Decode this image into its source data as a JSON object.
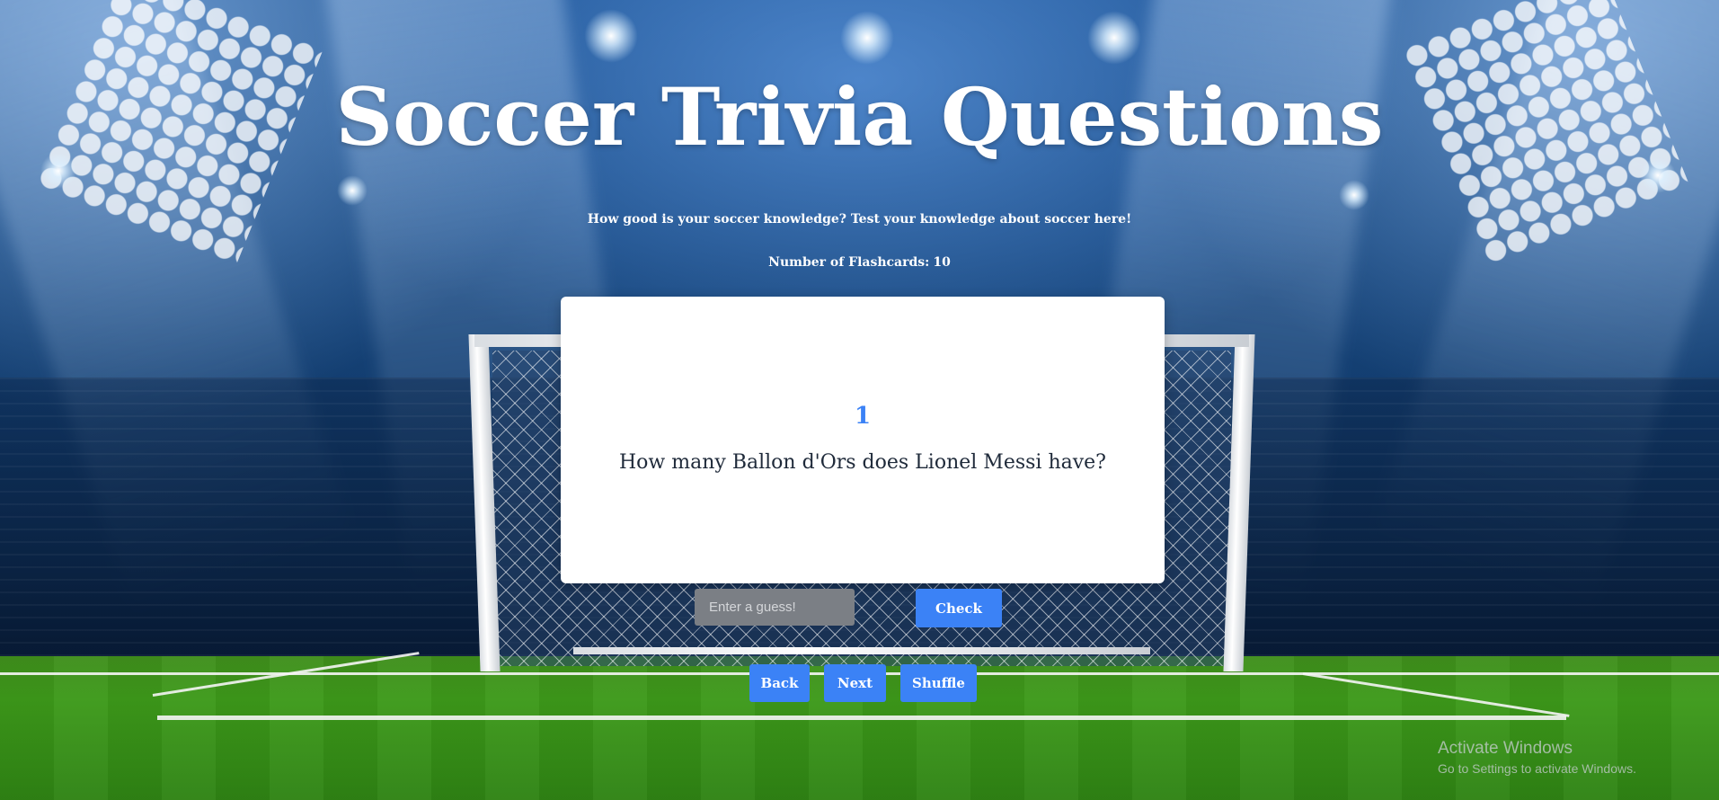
{
  "page": {
    "title": "Soccer Trivia Questions",
    "subtitle": "How good is your soccer knowledge? Test your knowledge about soccer here!",
    "flashcard_count_label": "Number of Flashcards:",
    "flashcard_count": "10"
  },
  "card": {
    "number": "1",
    "question": "How many Ballon d'Ors does Lionel Messi have?"
  },
  "guess": {
    "value": "",
    "placeholder": "Enter a guess!",
    "check_label": "Check"
  },
  "nav": {
    "back_label": "Back",
    "next_label": "Next",
    "shuffle_label": "Shuffle"
  },
  "watermark": {
    "title": "Activate Windows",
    "subtitle": "Go to Settings to activate Windows."
  },
  "colors": {
    "accent": "#3b82f6",
    "card_background": "#ffffff",
    "input_background": "#7b7f85",
    "title_text": "#ffffff"
  },
  "background": {
    "scene": "stadium-with-floodlights-and-goal-icon"
  }
}
